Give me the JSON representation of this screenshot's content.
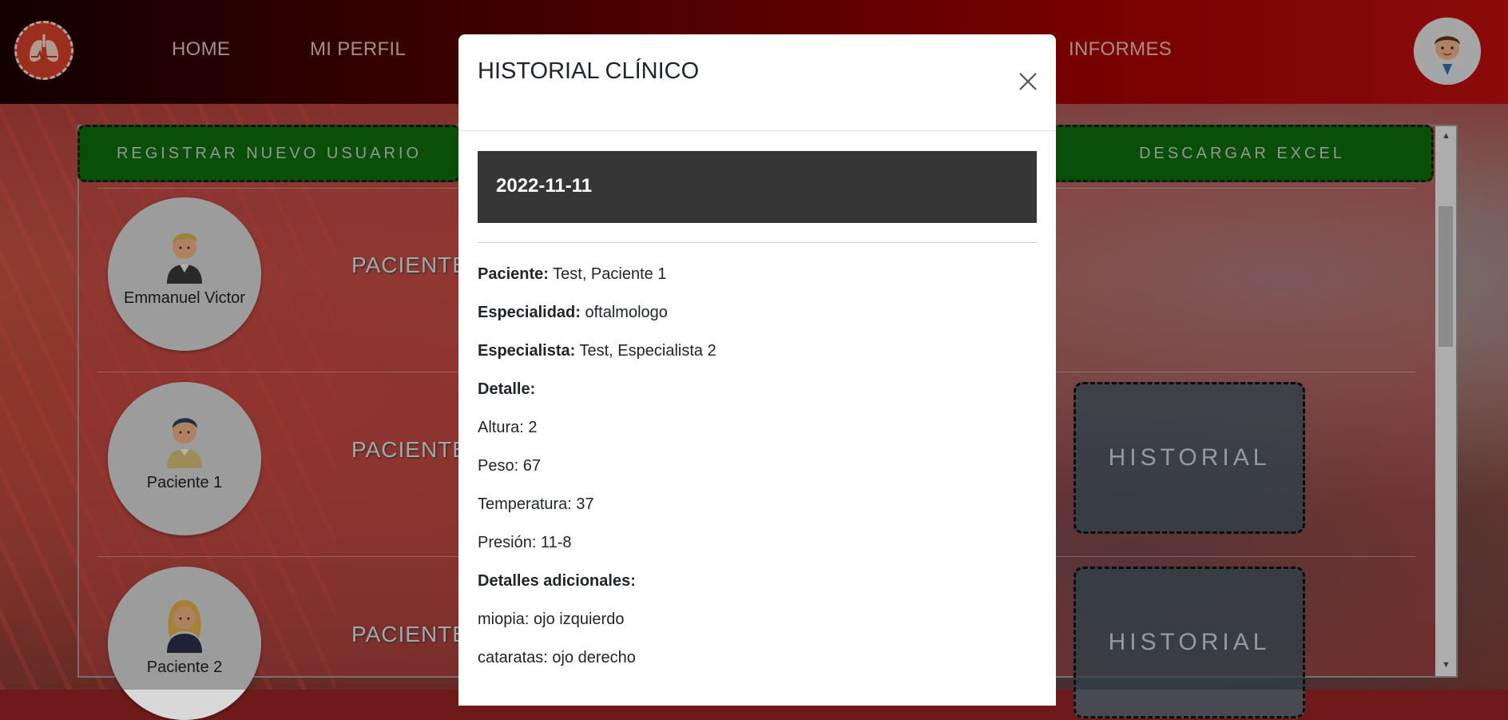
{
  "nav": {
    "links": [
      "HOME",
      "MI PERFIL",
      "INFORMES"
    ]
  },
  "toolbar": {
    "register_label": "REGISTRAR NUEVO USUARIO",
    "excel_label": "DESCARGAR EXCEL"
  },
  "patients": [
    {
      "name": "Emmanuel Victor",
      "label": "PACIENTE",
      "history_label": ""
    },
    {
      "name": "Paciente 1",
      "label": "PACIENTE",
      "history_label": "HISTORIAL"
    },
    {
      "name": "Paciente 2",
      "label": "PACIENTE",
      "history_label": "HISTORIAL"
    }
  ],
  "modal": {
    "title": "HISTORIAL CLÍNICO",
    "date": "2022-11-11",
    "paciente_label": "Paciente:",
    "paciente_value": "Test, Paciente 1",
    "especialidad_label": "Especialidad:",
    "especialidad_value": "oftalmologo",
    "especialista_label": "Especialista:",
    "especialista_value": "Test, Especialista 2",
    "detalle_label": "Detalle:",
    "altura": "Altura: 2",
    "peso": "Peso: 67",
    "temperatura": "Temperatura: 37",
    "presion": "Presión: 11-8",
    "adicionales_label": "Detalles adicionales:",
    "miopia": "miopia: ojo izquierdo",
    "cataratas": "cataratas: ojo derecho"
  },
  "colors": {
    "nav_gradient_end": "#c21010",
    "button_green": "#0f6e0a",
    "date_bar": "#363636"
  }
}
